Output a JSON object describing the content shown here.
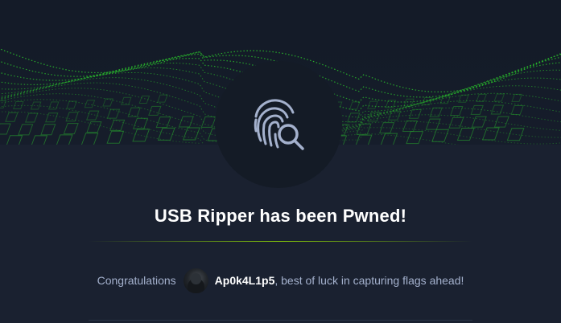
{
  "banner": {
    "accent_color": "#2bd62b",
    "pattern": "green-wave-grid"
  },
  "badge": {
    "icon": "fingerprint-search-icon",
    "icon_color": "#a4b1cd"
  },
  "title": "USB Ripper has been Pwned!",
  "congrats": {
    "prefix": "Congratulations",
    "username": "Ap0k4L1p5",
    "suffix": ", best of luck in capturing flags ahead!"
  }
}
